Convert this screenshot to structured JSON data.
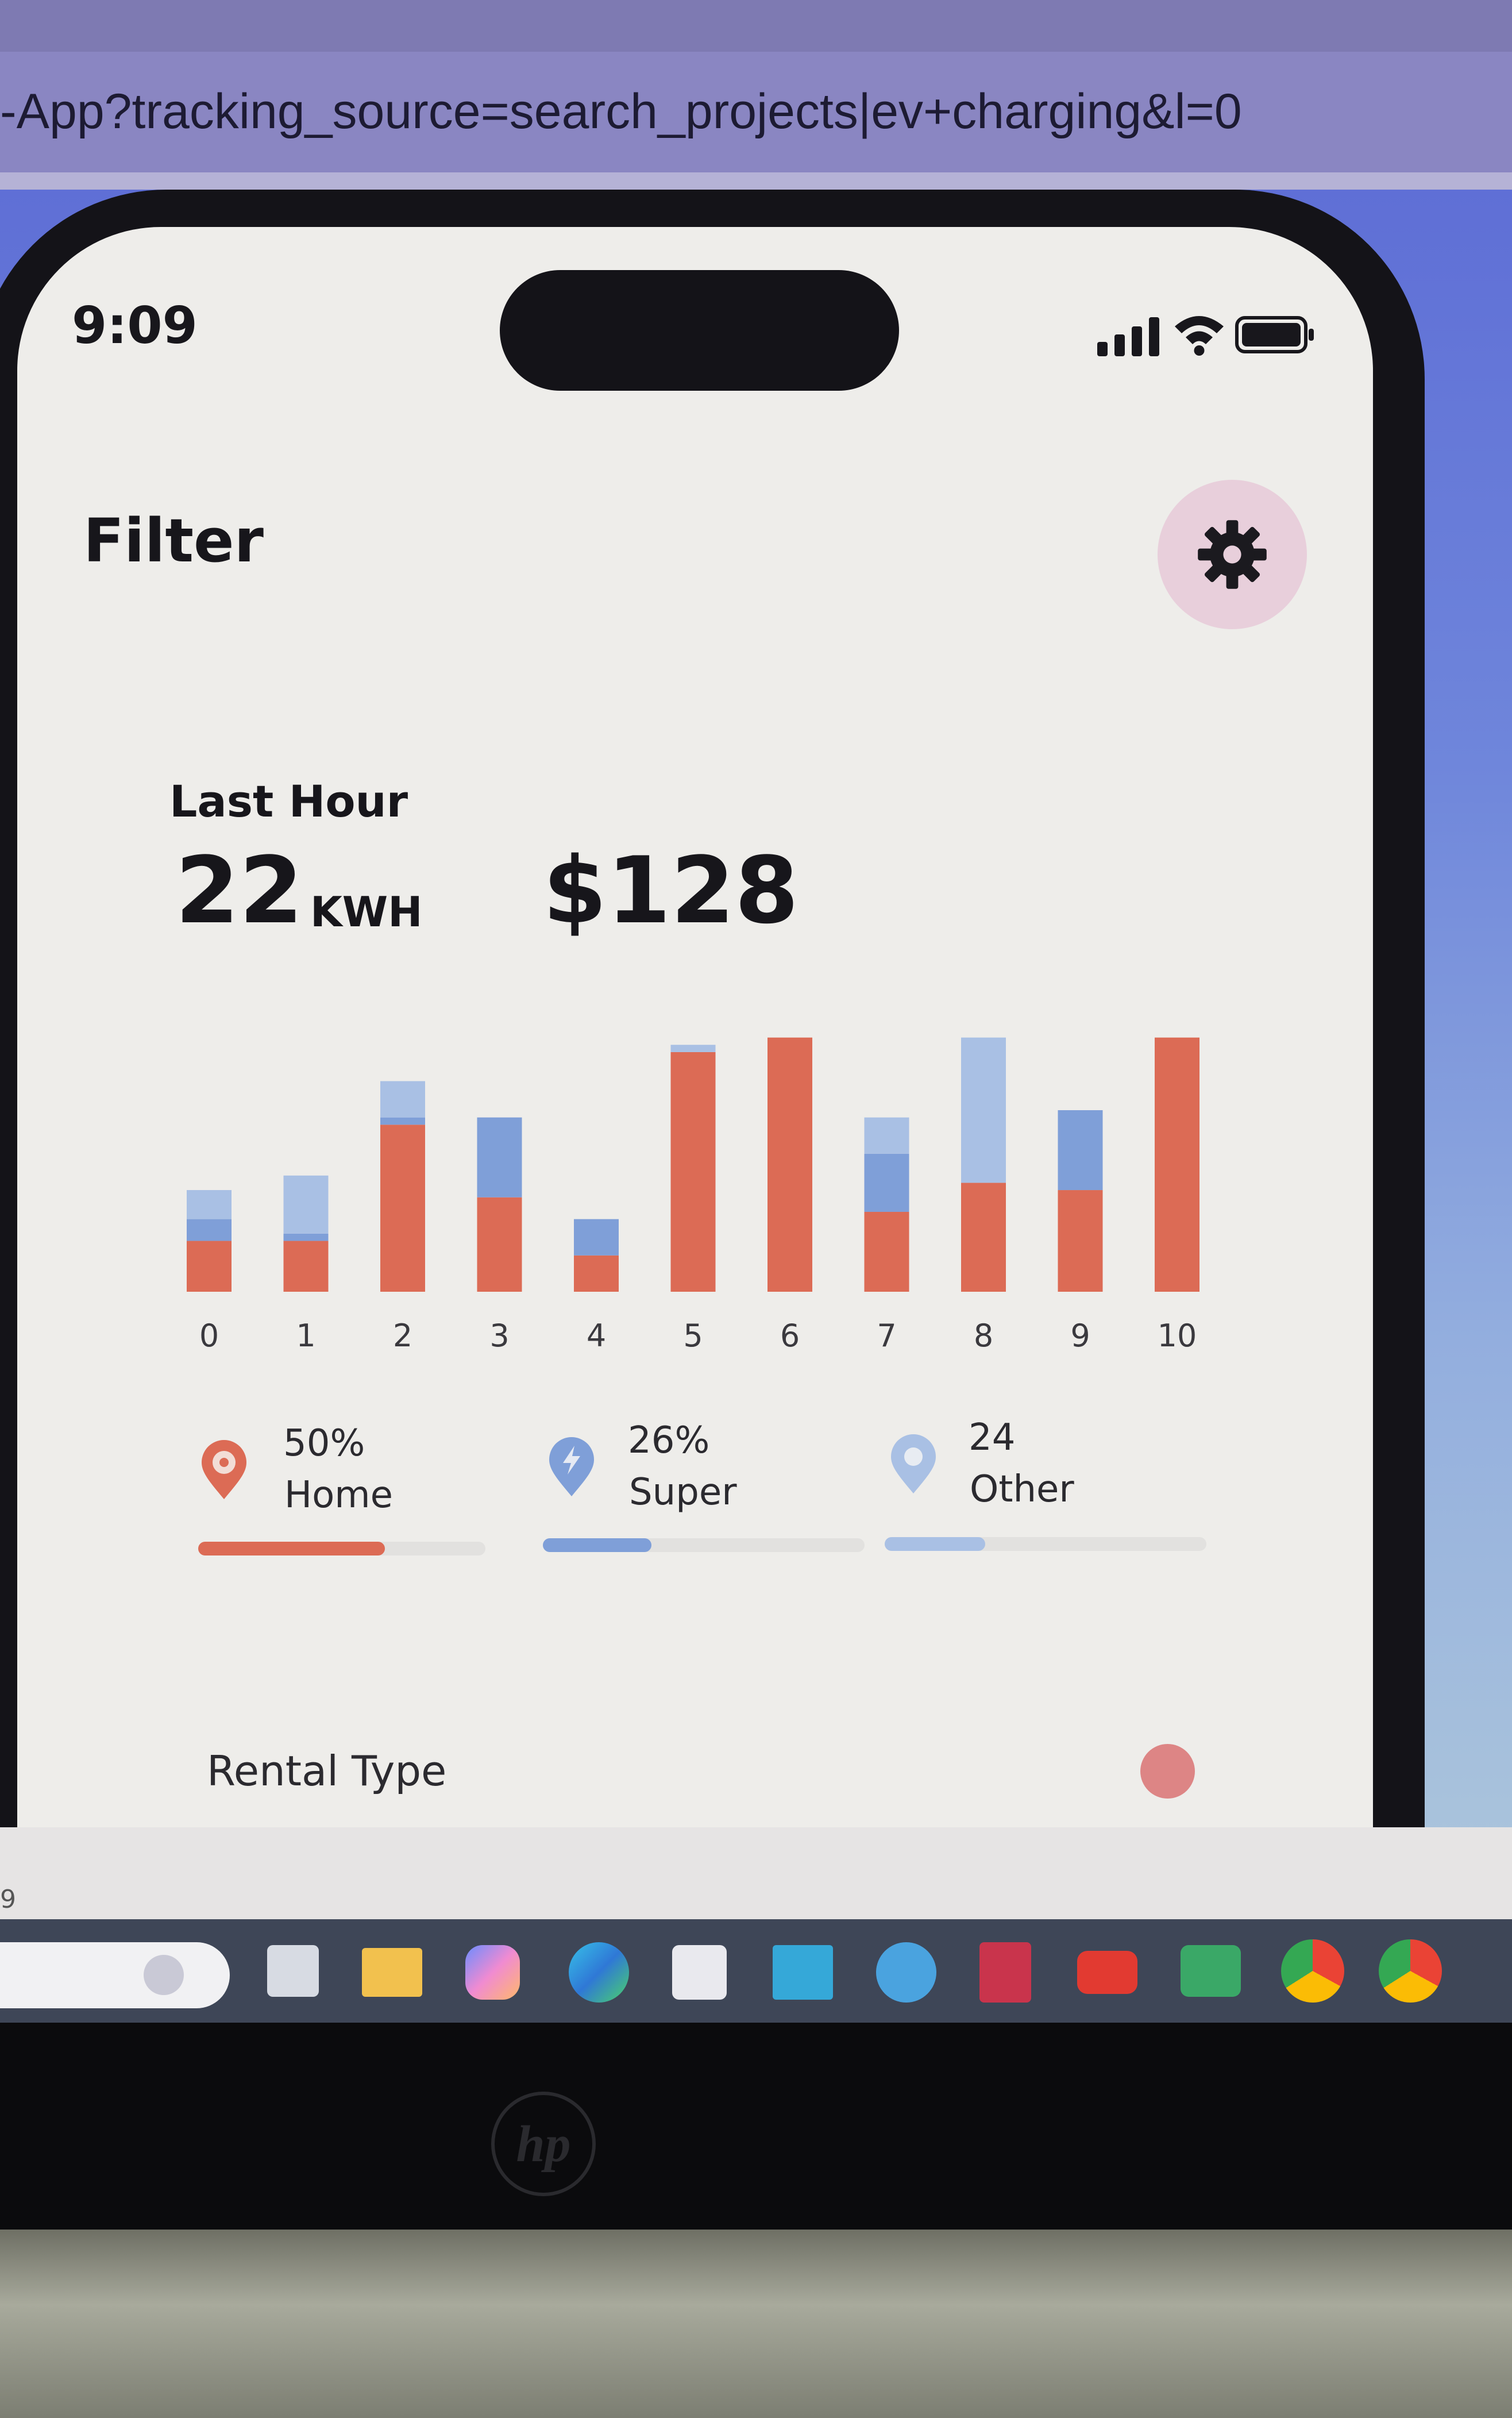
{
  "browser": {
    "url": "-App?tracking_source=search_projects|ev+charging&l=0"
  },
  "status_bar": {
    "time": "9:09"
  },
  "header": {
    "title": "Filter",
    "settings_icon": "gear-icon"
  },
  "summary": {
    "period_label": "Last Hour",
    "energy_value": "22",
    "energy_unit": "KWH",
    "cost": "$128"
  },
  "colors": {
    "home": "#dc6b55",
    "super": "#7f9fd8",
    "other": "#a9c0e4",
    "accent_bg": "#e8cfdb",
    "screen_bg": "#eeedea"
  },
  "chart_data": {
    "type": "bar",
    "stacked": true,
    "categories": [
      "0",
      "1",
      "2",
      "3",
      "4",
      "5",
      "6",
      "7",
      "8",
      "9",
      "10"
    ],
    "series": [
      {
        "values": [
          3.5,
          3.5,
          11.5,
          6.5,
          2.5,
          16.5,
          17.5,
          5.5,
          7.5,
          7,
          17.5
        ]
      },
      {
        "values": [
          1.5,
          0.5,
          0.5,
          5.5,
          2.5,
          0,
          0,
          4,
          0,
          5.5,
          0
        ]
      },
      {
        "values": [
          2,
          4,
          2.5,
          0,
          0,
          0.5,
          0,
          2.5,
          10,
          0,
          0
        ]
      }
    ],
    "ylim": [
      0,
      18
    ]
  },
  "legend": [
    {
      "percent": "50%",
      "label": "Home",
      "icon": "home-pin-icon",
      "fill": 0.5
    },
    {
      "percent": "26%",
      "label": "Super",
      "icon": "lightning-pin-icon",
      "fill": 0.26
    },
    {
      "percent": "24",
      "label": "Other",
      "icon": "pin-icon",
      "fill": 0.24
    }
  ],
  "rental": {
    "label": "Rental Type"
  },
  "desktop": {
    "misc_text": "9",
    "taskbar_icons": [
      "search-box",
      "task-view-icon",
      "file-explorer-icon",
      "copilot-icon",
      "edge-icon",
      "store-icon",
      "myhp-icon",
      "help-icon",
      "mcafee-icon",
      "youtube-icon",
      "meet-icon",
      "chrome-icon",
      "chrome-profile-icon"
    ],
    "brand": "hp"
  }
}
